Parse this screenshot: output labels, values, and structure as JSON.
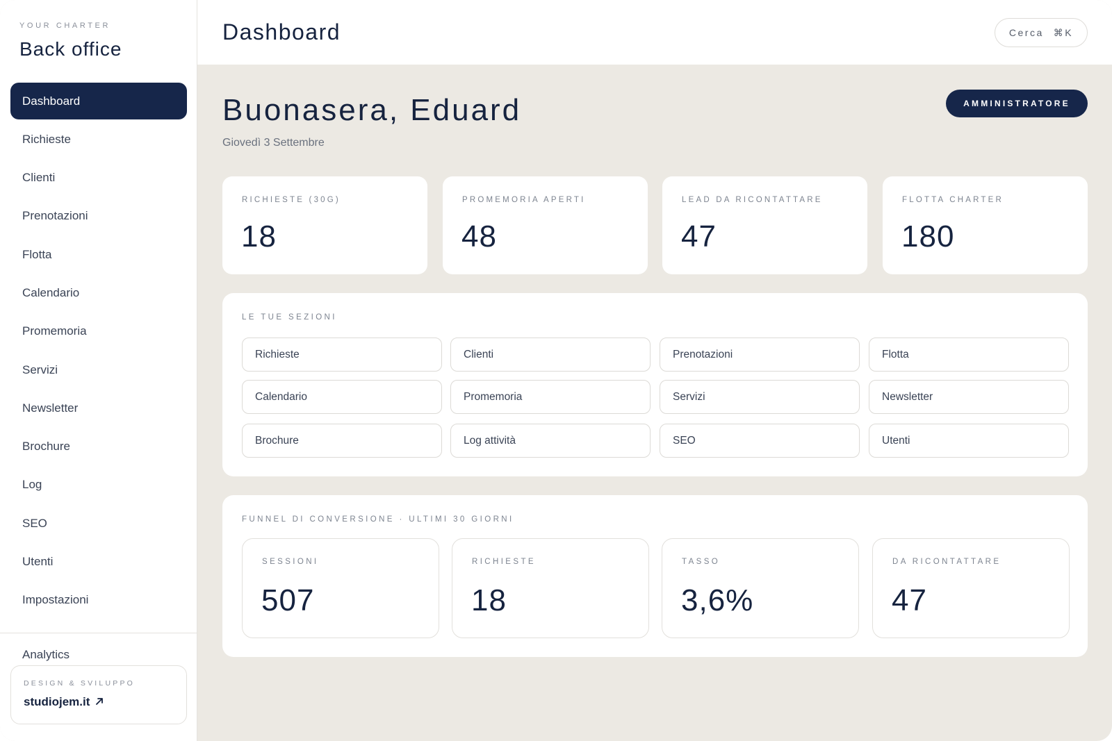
{
  "brand": {
    "eyebrow": "YOUR CHARTER",
    "title": "Back office"
  },
  "sidebar": {
    "items": [
      {
        "label": "Dashboard",
        "active": true
      },
      {
        "label": "Richieste"
      },
      {
        "label": "Clienti"
      },
      {
        "label": "Prenotazioni"
      },
      {
        "label": "Flotta"
      },
      {
        "label": "Calendario"
      },
      {
        "label": "Promemoria"
      },
      {
        "label": "Servizi"
      },
      {
        "label": "Newsletter"
      },
      {
        "label": "Brochure"
      },
      {
        "label": "Log"
      },
      {
        "label": "SEO"
      },
      {
        "label": "Utenti"
      },
      {
        "label": "Impostazioni"
      }
    ],
    "analytics": "Analytics",
    "credit": {
      "eyebrow": "DESIGN & SVILUPPO",
      "link": "studiojem.it",
      "link_icon": "arrow-up-right-icon"
    }
  },
  "header": {
    "title": "Dashboard",
    "search_label": "Cerca",
    "search_shortcut": "⌘K"
  },
  "main": {
    "greeting": "Buonasera, Eduard",
    "date": "Giovedì 3 Settembre",
    "role_badge": "AMMINISTRATORE",
    "stats": [
      {
        "label": "RICHIESTE (30G)",
        "value": "18"
      },
      {
        "label": "PROMEMORIA APERTI",
        "value": "48"
      },
      {
        "label": "LEAD DA RICONTATTARE",
        "value": "47"
      },
      {
        "label": "FLOTTA CHARTER",
        "value": "180"
      }
    ],
    "sections": {
      "title": "LE TUE SEZIONI",
      "items": [
        "Richieste",
        "Clienti",
        "Prenotazioni",
        "Flotta",
        "Calendario",
        "Promemoria",
        "Servizi",
        "Newsletter",
        "Brochure",
        "Log attività",
        "SEO",
        "Utenti"
      ]
    },
    "funnel": {
      "title": "FUNNEL DI CONVERSIONE · ULTIMI 30 GIORNI",
      "cards": [
        {
          "label": "SESSIONI",
          "value": "507"
        },
        {
          "label": "RICHIESTE",
          "value": "18"
        },
        {
          "label": "TASSO",
          "value": "3,6%"
        },
        {
          "label": "DA RICONTATTARE",
          "value": "47"
        }
      ]
    }
  },
  "colors": {
    "navy": "#16264a",
    "background": "#ece9e3",
    "surface": "#ffffff",
    "muted_text": "#7d8490"
  }
}
